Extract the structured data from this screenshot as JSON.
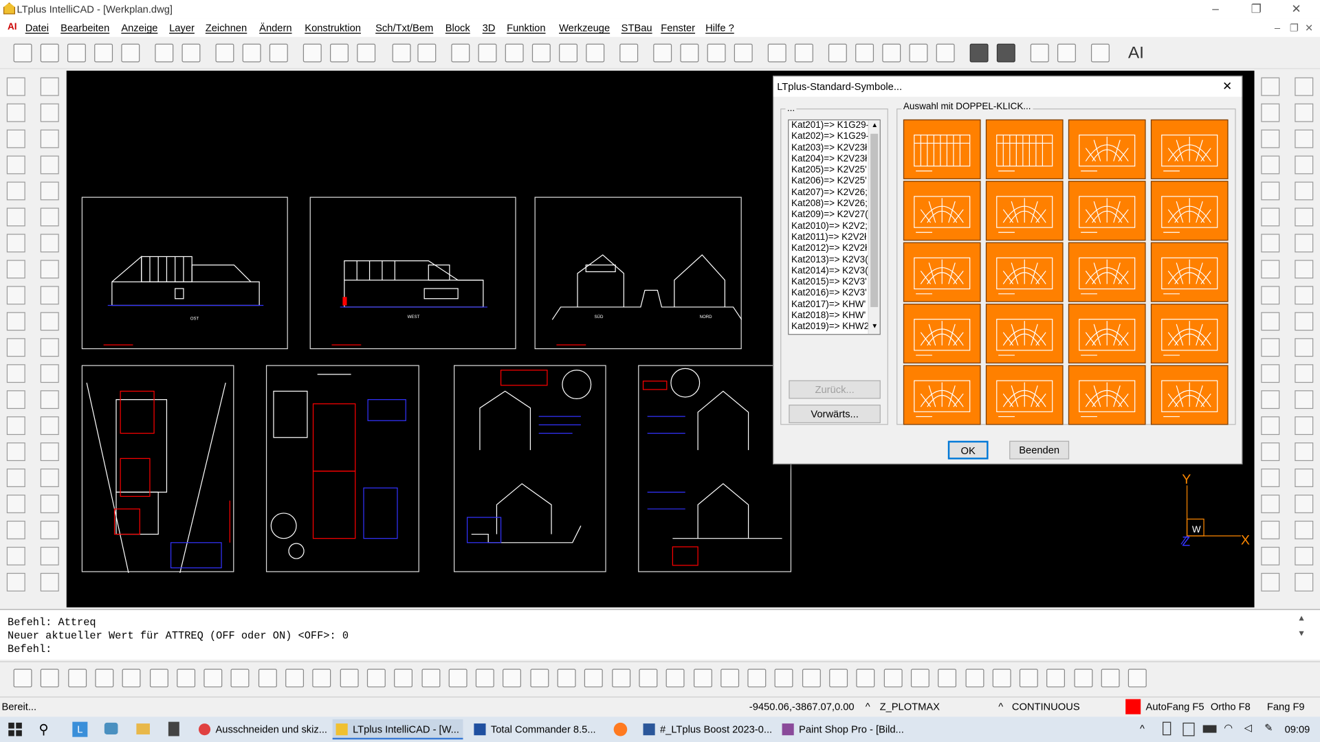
{
  "window": {
    "title": "LTplus IntelliCAD - [Werkplan.dwg]",
    "controls": [
      "–",
      "❐",
      "✕"
    ]
  },
  "menu": {
    "app_icon": "AI",
    "items": [
      "Datei",
      "Bearbeiten",
      "Anzeige",
      "Layer",
      "Zeichnen",
      "Ändern",
      "Konstruktion",
      "Sch/Txt/Bem",
      "Block",
      "3D",
      "Funktion",
      "Werkzeuge",
      "STBau",
      "Fenster",
      "Hilfe ?"
    ],
    "mdi_controls": [
      "–",
      "❐",
      "✕"
    ]
  },
  "toolbar": {
    "ai_label": "AI"
  },
  "drawing": {
    "ucs": {
      "x": "X",
      "y": "Y",
      "z": "Z",
      "w": "W"
    }
  },
  "dialog": {
    "title": "LTplus-Standard-Symbole...",
    "list_group": "...",
    "tiles_group": "Auswahl mit DOPPEL-KLICK...",
    "list": [
      "Kat201)=> K1G29-",
      "Kat202)=> K1G29-",
      "Kat203)=> K2V23ł",
      "Kat204)=> K2V23ł",
      "Kat205)=> K2V25'",
      "Kat206)=> K2V25'",
      "Kat207)=> K2V26;",
      "Kat208)=> K2V26;",
      "Kat209)=> K2V27(",
      "Kat2010)=> K2V2;",
      "Kat2011)=> K2V2ł",
      "Kat2012)=> K2V2ł",
      "Kat2013)=> K2V3(",
      "Kat2014)=> K2V3(",
      "Kat2015)=> K2V3'",
      "Kat2016)=> K2V3'",
      "Kat2017)=> KHW'",
      "Kat2018)=> KHW'",
      "Kat2019)=> KHW2"
    ],
    "back_button": "Zurück...",
    "forward_button": "Vorwärts...",
    "ok_button": "OK",
    "close_button": "Beenden",
    "tile_count": 20,
    "tile_color": "#ff8000"
  },
  "command": {
    "lines": [
      "Befehl: Attreq",
      "Neuer aktueller Wert für ATTREQ (OFF oder ON) <OFF>: 0",
      "Befehl:"
    ]
  },
  "status": {
    "ready": "Bereit...",
    "coords": "-9450.06,-3867.07,0.00",
    "layer": "Z_PLOTMAX",
    "linetype": "CONTINUOUS",
    "color": "#ff0000",
    "autofang": "AutoFang F5",
    "ortho": "Ortho F8",
    "fang": "Fang F9"
  },
  "taskbar": {
    "items": [
      "Ausschneiden und skiz...",
      "LTplus IntelliCAD - [W...",
      "Total Commander 8.5...",
      "#_LTplus Boost 2023-0...",
      "Paint Shop Pro - [Bild..."
    ],
    "time": "09:09"
  }
}
